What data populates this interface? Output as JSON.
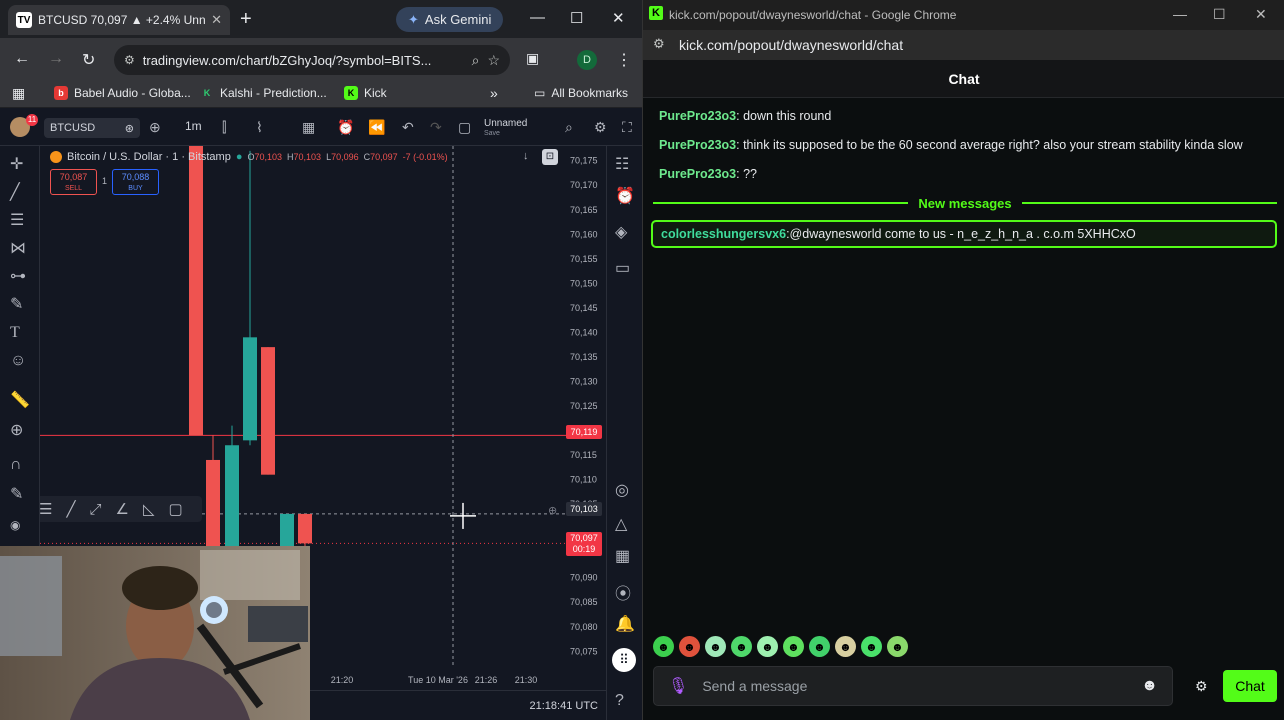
{
  "left_browser": {
    "tab_title": "BTCUSD 70,097 ▲ +2.4% Unna",
    "new_tab": "+",
    "gemini": "Ask Gemini",
    "url": "tradingview.com/chart/bZGhyJoq/?symbol=BITS...",
    "profile": "D",
    "bookmarks": [
      "Babel Audio - Globa...",
      "Kalshi - Prediction...",
      "Kick"
    ],
    "all_bookmarks": "All Bookmarks"
  },
  "tradingview": {
    "symbol": "BTCUSD",
    "interval": "1m",
    "layout_name": "Unnamed",
    "layout_status": "Save",
    "legend_title": "Bitcoin / U.S. Dollar · 1 · Bitstamp",
    "ohlc": {
      "o": "70,103",
      "h": "70,103",
      "l": "70,096",
      "c": "70,097",
      "chg": "-7 (-0.01%)"
    },
    "sell_price": "70,087",
    "sell_label": "SELL",
    "spread": "1",
    "buy_price": "70,088",
    "buy_label": "BUY",
    "badge_last": "70,119",
    "badge_cross": "70,103",
    "badge_current": "70,097",
    "badge_countdown": "00:19",
    "clock": "21:18:41 UTC",
    "colors": {
      "up": "#26a69a",
      "down": "#ef5350",
      "bg": "#131722"
    }
  },
  "chart_data": {
    "type": "candlestick",
    "x_tick_labels": [
      "21:20",
      "Tue 10 Mar '26",
      "21:26",
      "21:30"
    ],
    "y_tick_labels": [
      70175,
      70170,
      70165,
      70160,
      70155,
      70150,
      70145,
      70140,
      70135,
      70130,
      70125,
      70115,
      70110,
      70105,
      70090,
      70085,
      70080,
      70075
    ],
    "ylim": [
      70072,
      70178
    ],
    "candles": [
      {
        "o": 70119,
        "c": 70180,
        "h": 70190,
        "l": 70119,
        "dir": "down"
      },
      {
        "o": 70114,
        "c": 70080,
        "h": 70119,
        "l": 70060,
        "dir": "down"
      },
      {
        "o": 70080,
        "c": 70117,
        "h": 70121,
        "l": 70080,
        "dir": "up"
      },
      {
        "o": 70118,
        "c": 70139,
        "h": 70177,
        "l": 70117,
        "dir": "up"
      },
      {
        "o": 70137,
        "c": 70111,
        "h": 70137,
        "l": 70111,
        "dir": "down"
      },
      {
        "o": 70080,
        "c": 70103,
        "h": 70103,
        "l": 70078,
        "dir": "up"
      },
      {
        "o": 70103,
        "c": 70097,
        "h": 70103,
        "l": 70096,
        "dir": "down"
      }
    ]
  },
  "kick": {
    "window_title": "kick.com/popout/dwaynesworld/chat - Google Chrome",
    "address": "kick.com/popout/dwaynesworld/chat",
    "chat_header": "Chat",
    "messages": [
      {
        "user": "PurePro23o3",
        "text": " down this round"
      },
      {
        "user": "PurePro23o3",
        "text": " think its supposed to be the 60 second average right? also your stream stability kinda slow"
      },
      {
        "user": "PurePro23o3",
        "text": " ??"
      }
    ],
    "new_messages_label": "New messages",
    "highlight": {
      "user": "colorlesshungersvx6",
      "text": " @dwaynesworld come to us - n_e_z_h_n_a . c.o.m 5XHHCxO"
    },
    "input_placeholder": "Send a message",
    "send_label": "Chat",
    "accent": "#53fc18"
  }
}
